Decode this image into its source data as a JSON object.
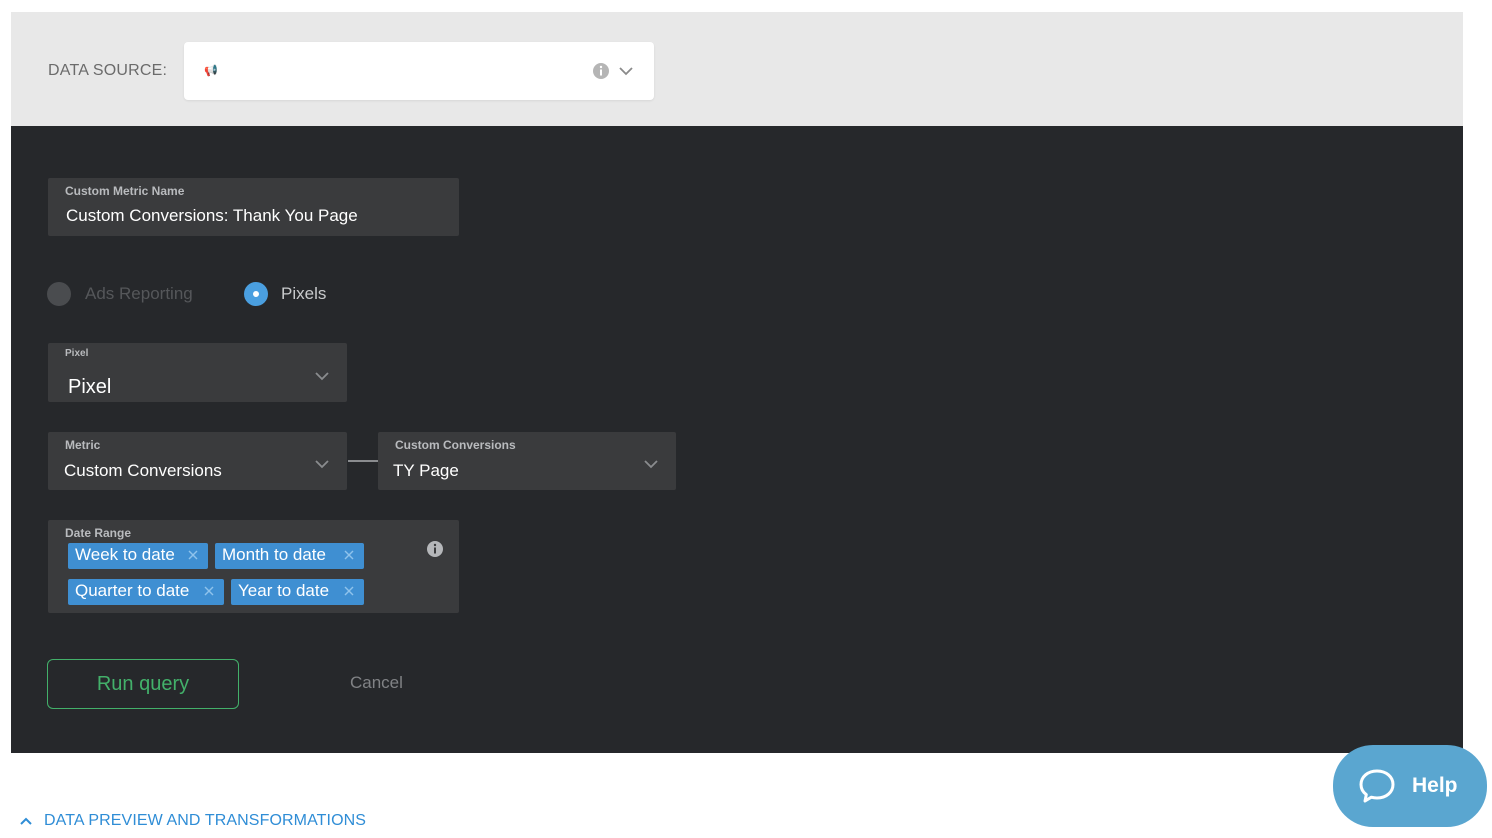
{
  "data_source": {
    "label": "DATA SOURCE:",
    "selected_glyph": "📢",
    "info_icon": "info-icon",
    "chevron_icon": "chevron-down-icon"
  },
  "custom_metric_name": {
    "label": "Custom Metric Name",
    "value": "Custom Conversions: Thank You Page"
  },
  "report_type": {
    "options": [
      {
        "label": "Ads Reporting",
        "selected": false
      },
      {
        "label": "Pixels",
        "selected": true
      }
    ]
  },
  "pixel": {
    "label": "Pixel",
    "value": "Pixel"
  },
  "metric": {
    "label": "Metric",
    "value": "Custom Conversions"
  },
  "custom_conversions": {
    "label": "Custom Conversions",
    "value": "TY Page"
  },
  "date_range": {
    "label": "Date Range",
    "chips": [
      "Week to date",
      "Month to date",
      "Quarter to date",
      "Year to date"
    ]
  },
  "actions": {
    "run_label": "Run query",
    "cancel_label": "Cancel"
  },
  "preview": {
    "label": "DATA PREVIEW AND TRANSFORMATIONS"
  },
  "help": {
    "label": "Help"
  },
  "colors": {
    "panel": "#26282b",
    "field": "#3a3b3d",
    "accent_blue": "#4a9fe0",
    "chip_blue": "#3f8fd2",
    "run_green": "#43b06a",
    "help_blue": "#5aa6d0"
  }
}
